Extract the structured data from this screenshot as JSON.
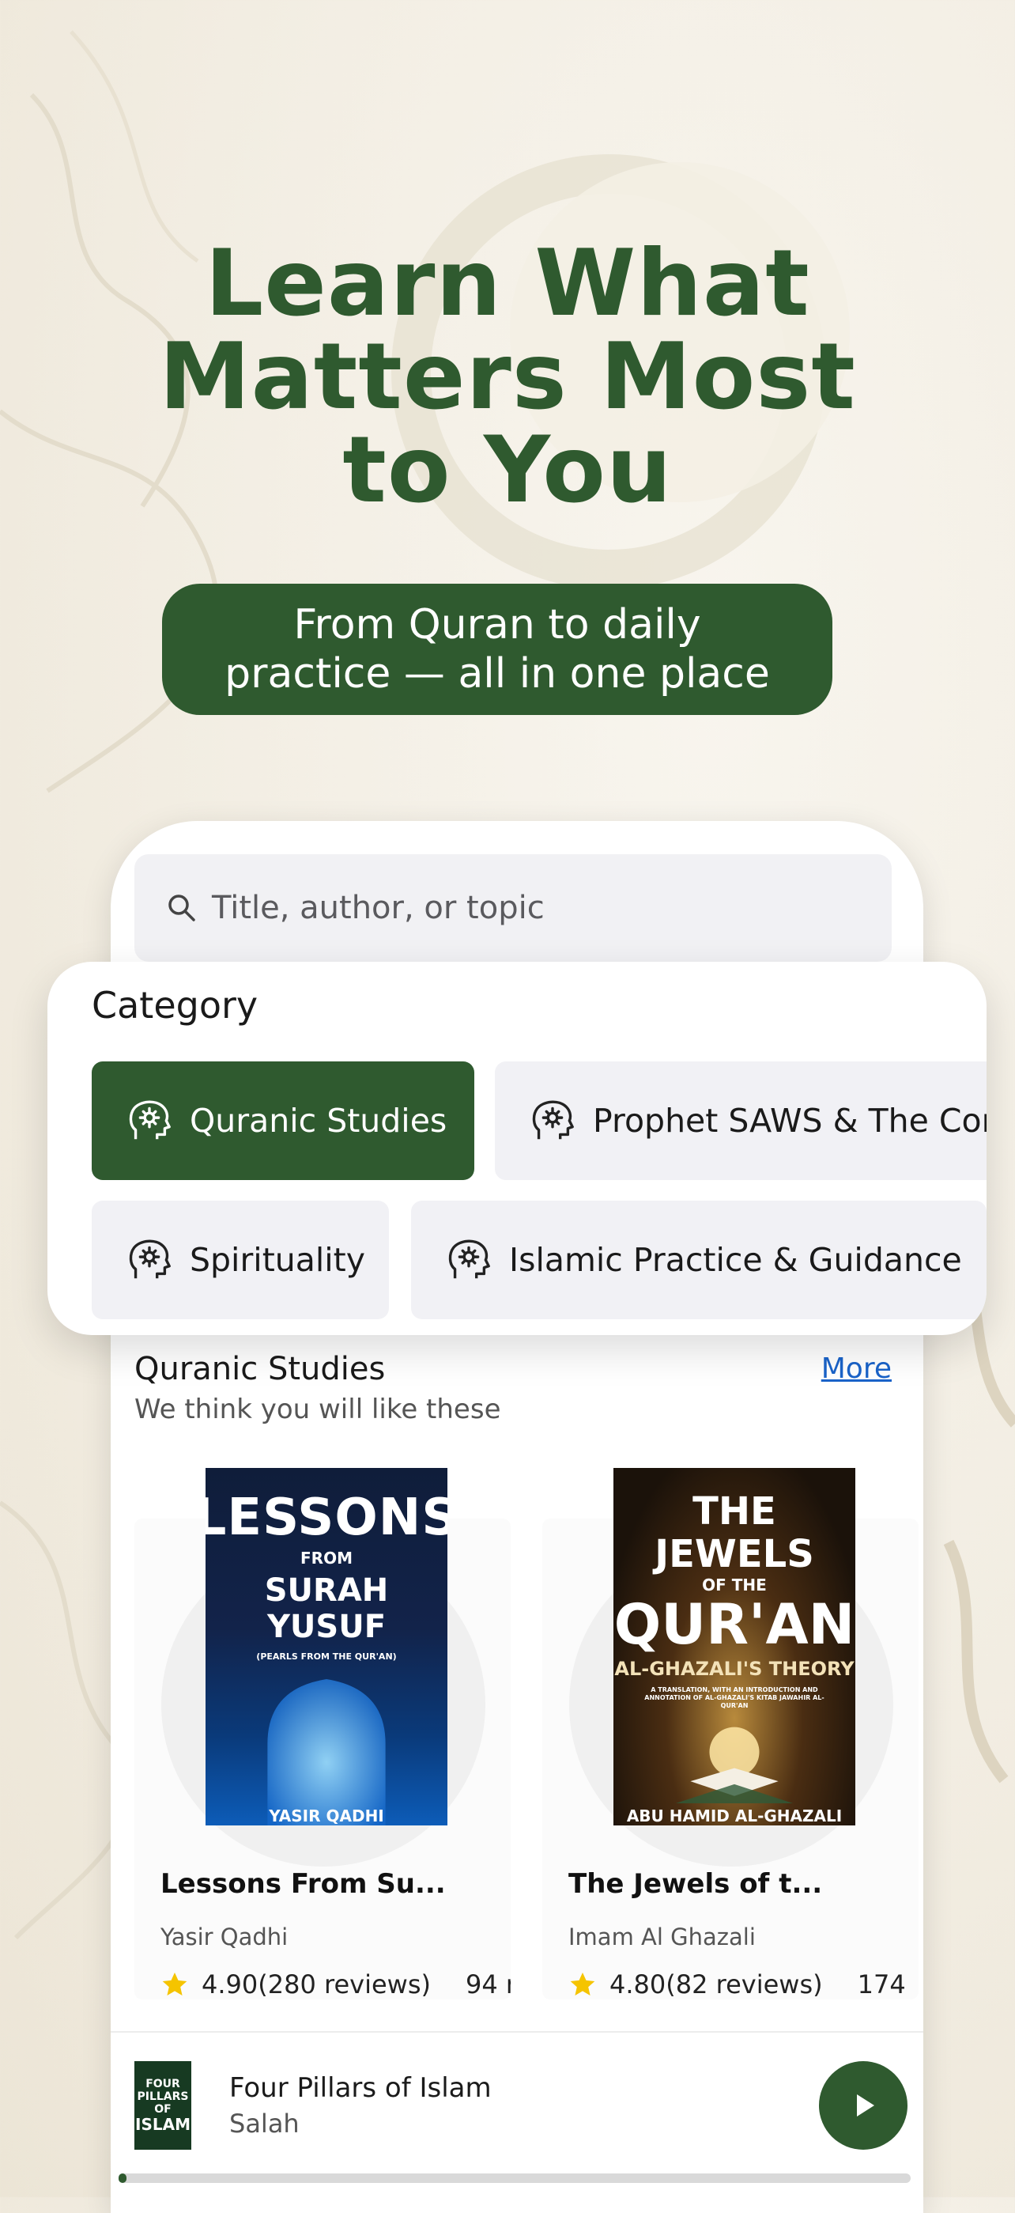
{
  "hero": {
    "headline_lines": [
      "Learn What",
      "Matters Most",
      "to You"
    ],
    "tagline_lines": [
      "From Quran to daily",
      "practice — all in one place"
    ]
  },
  "search": {
    "placeholder": "Title, author, or topic",
    "icon": "search-icon"
  },
  "category": {
    "title": "Category",
    "chips": [
      {
        "label": "Quranic Studies",
        "active": true,
        "icon": "head-gear-icon"
      },
      {
        "label": "Prophet SAWS & The Cor",
        "active": false,
        "icon": "head-gear-icon"
      },
      {
        "label": "Spirituality",
        "active": false,
        "icon": "head-gear-icon"
      },
      {
        "label": "Islamic Practice & Guidance",
        "active": false,
        "icon": "head-gear-icon"
      }
    ]
  },
  "section": {
    "title": "Quranic Studies",
    "subtitle": "We think you will like these",
    "more_label": "More"
  },
  "books": [
    {
      "title": "Lessons From Su...",
      "author": "Yasir Qadhi",
      "rating": "4.90(280 reviews)",
      "count": "94 r",
      "cover": {
        "line1": "LESSONS",
        "line2": "FROM",
        "line3": "SURAH YUSUF",
        "line4": "(PEARLS FROM THE QUR'AN)",
        "author": "YASIR QADHI"
      }
    },
    {
      "title": "The Jewels of t...",
      "author": "Imam Al Ghazali",
      "rating": "4.80(82 reviews)",
      "count": "174",
      "cover": {
        "line1": "THE JEWELS",
        "line2": "OF THE",
        "line3": "QUR'AN",
        "line4": "AL-GHAZALI'S THEORY",
        "line5": "A TRANSLATION, WITH AN INTRODUCTION AND ANNOTATION OF AL-GHAZALI'S KITAB JAWAHIR AL-QUR'AN",
        "author": "ABU HAMID AL-GHAZALI"
      }
    }
  ],
  "player": {
    "title": "Four Pillars of Islam",
    "subtitle": "Salah",
    "thumb_lines": [
      "FOUR PILLARS",
      "OF",
      "ISLAM"
    ],
    "progress": 0.01
  },
  "colors": {
    "accent": "#2f5a2f",
    "link": "#1a63c9",
    "star": "#f5c400"
  }
}
